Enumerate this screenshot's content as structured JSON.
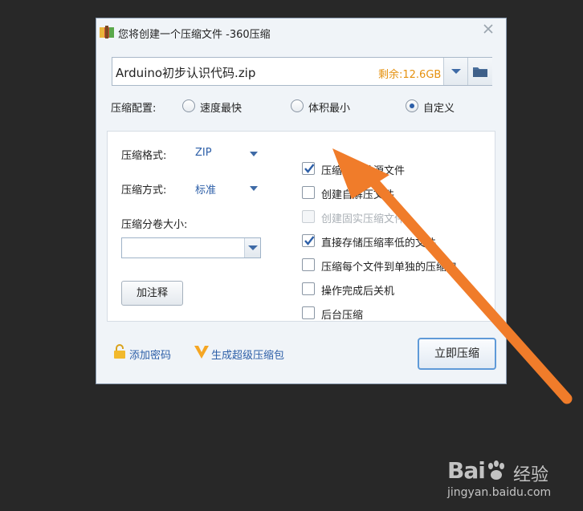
{
  "window": {
    "title": "您将创建一个压缩文件 -360压缩"
  },
  "path_bar": {
    "value": "Arduino初步认识代码.zip",
    "space": "剩余:12.6GB"
  },
  "config": {
    "label": "压缩配置:",
    "options": [
      "速度最快",
      "体积最小",
      "自定义"
    ],
    "selected": "自定义"
  },
  "options_panel": {
    "format_label": "压缩格式:",
    "format_value": "ZIP",
    "method_label": "压缩方式:",
    "method_value": "标准",
    "volume_label": "压缩分卷大小:",
    "volume_value": "",
    "comment_button": "加注释",
    "checkboxes": [
      {
        "label": "压缩后删除源文件",
        "checked": true,
        "enabled": true
      },
      {
        "label": "创建自解压文件",
        "checked": false,
        "enabled": true
      },
      {
        "label": "创建固实压缩文件",
        "checked": false,
        "enabled": false
      },
      {
        "label": "直接存储压缩率低的文件",
        "checked": true,
        "enabled": true
      },
      {
        "label": "压缩每个文件到单独的压缩包",
        "checked": false,
        "enabled": true
      },
      {
        "label": "操作完成后关机",
        "checked": false,
        "enabled": true
      },
      {
        "label": "后台压缩",
        "checked": false,
        "enabled": true
      }
    ]
  },
  "footer": {
    "add_password": "添加密码",
    "super_archive": "生成超级压缩包",
    "compress_button": "立即压缩"
  },
  "annotation": {
    "arrow_color": "#f07c2a"
  },
  "watermark": {
    "brand": "Bai",
    "brand_cn": "经验",
    "url": "jingyan.baidu.com"
  },
  "colors": {
    "background": "#282828",
    "accent": "#2d5fa8",
    "space_text": "#e5910f"
  }
}
